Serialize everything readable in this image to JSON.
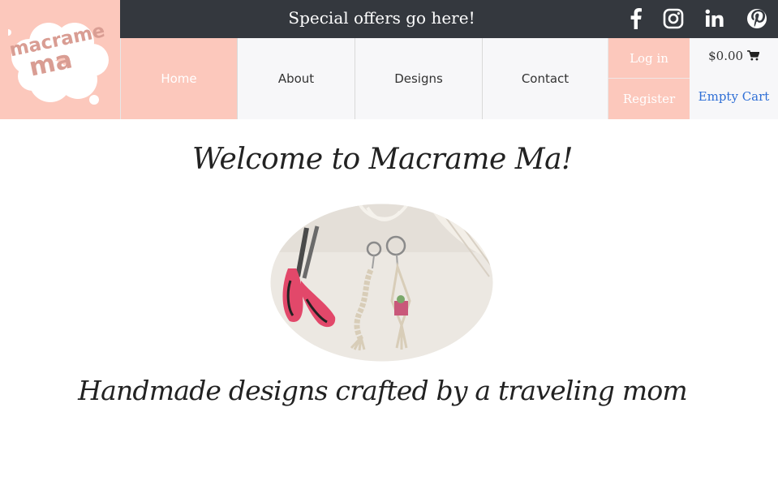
{
  "brand": {
    "logo_line1": "macrame",
    "logo_line2": "ma",
    "background_color": "#fcc8bc",
    "logo_text_color": "#d99d93"
  },
  "topbar": {
    "offer_text": "Special offers go here!",
    "background_color": "#34383e",
    "social_icons": [
      "facebook-icon",
      "instagram-icon",
      "linkedin-icon",
      "pinterest-icon"
    ]
  },
  "nav": {
    "items": [
      {
        "label": "Home",
        "active": true
      },
      {
        "label": "About"
      },
      {
        "label": "Designs"
      },
      {
        "label": "Contact"
      }
    ]
  },
  "account": {
    "login_label": "Log in",
    "register_label": "Register"
  },
  "cart": {
    "total": "$0.00",
    "icon": "shopping-cart-icon",
    "empty_label": "Empty Cart",
    "link_color": "#2f6fd6"
  },
  "main": {
    "heading": "Welcome to Macrame Ma!",
    "image_icon": "macrame-keychains-photo",
    "tagline": "Handmade designs crafted by a traveling mom"
  }
}
